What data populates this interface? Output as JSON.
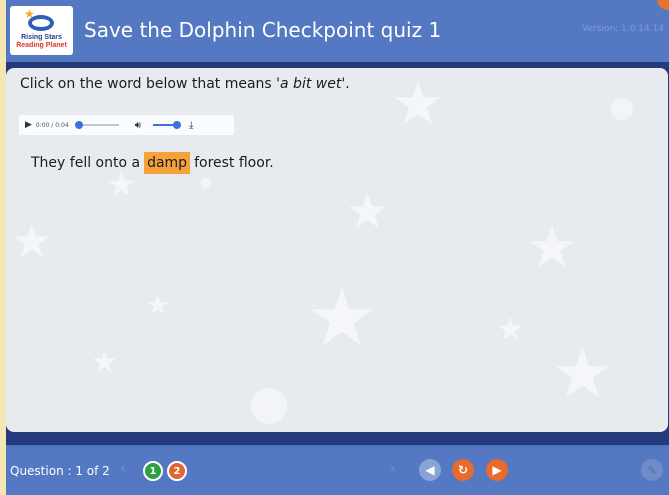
{
  "header": {
    "title": "Save the Dolphin Checkpoint quiz 1",
    "version": "Version: 1.0.14.14",
    "logo": {
      "line1": "Rising Stars",
      "line2": "Reading Planet"
    }
  },
  "question": {
    "prompt_before": "Click on the word below that means '",
    "prompt_italic": "a bit wet",
    "prompt_after": "'.",
    "sentence": {
      "before": "They fell onto a",
      "highlighted_word": "damp",
      "after": "forest floor."
    }
  },
  "audio": {
    "time": "0:00 / 0:04",
    "progress": 0,
    "volume": 1
  },
  "footer": {
    "question_counter": "Question : 1 of 2",
    "question_numbers": [
      "1",
      "2"
    ]
  },
  "colors": {
    "header_blue": "#5479c2",
    "highlight": "#f5a23a",
    "answered_green": "#2ea043",
    "current_orange": "#e1652f"
  },
  "icons": [
    "play-icon",
    "volume-icon",
    "download-icon",
    "prev-icon",
    "refresh-icon",
    "next-icon",
    "submit-icon"
  ]
}
